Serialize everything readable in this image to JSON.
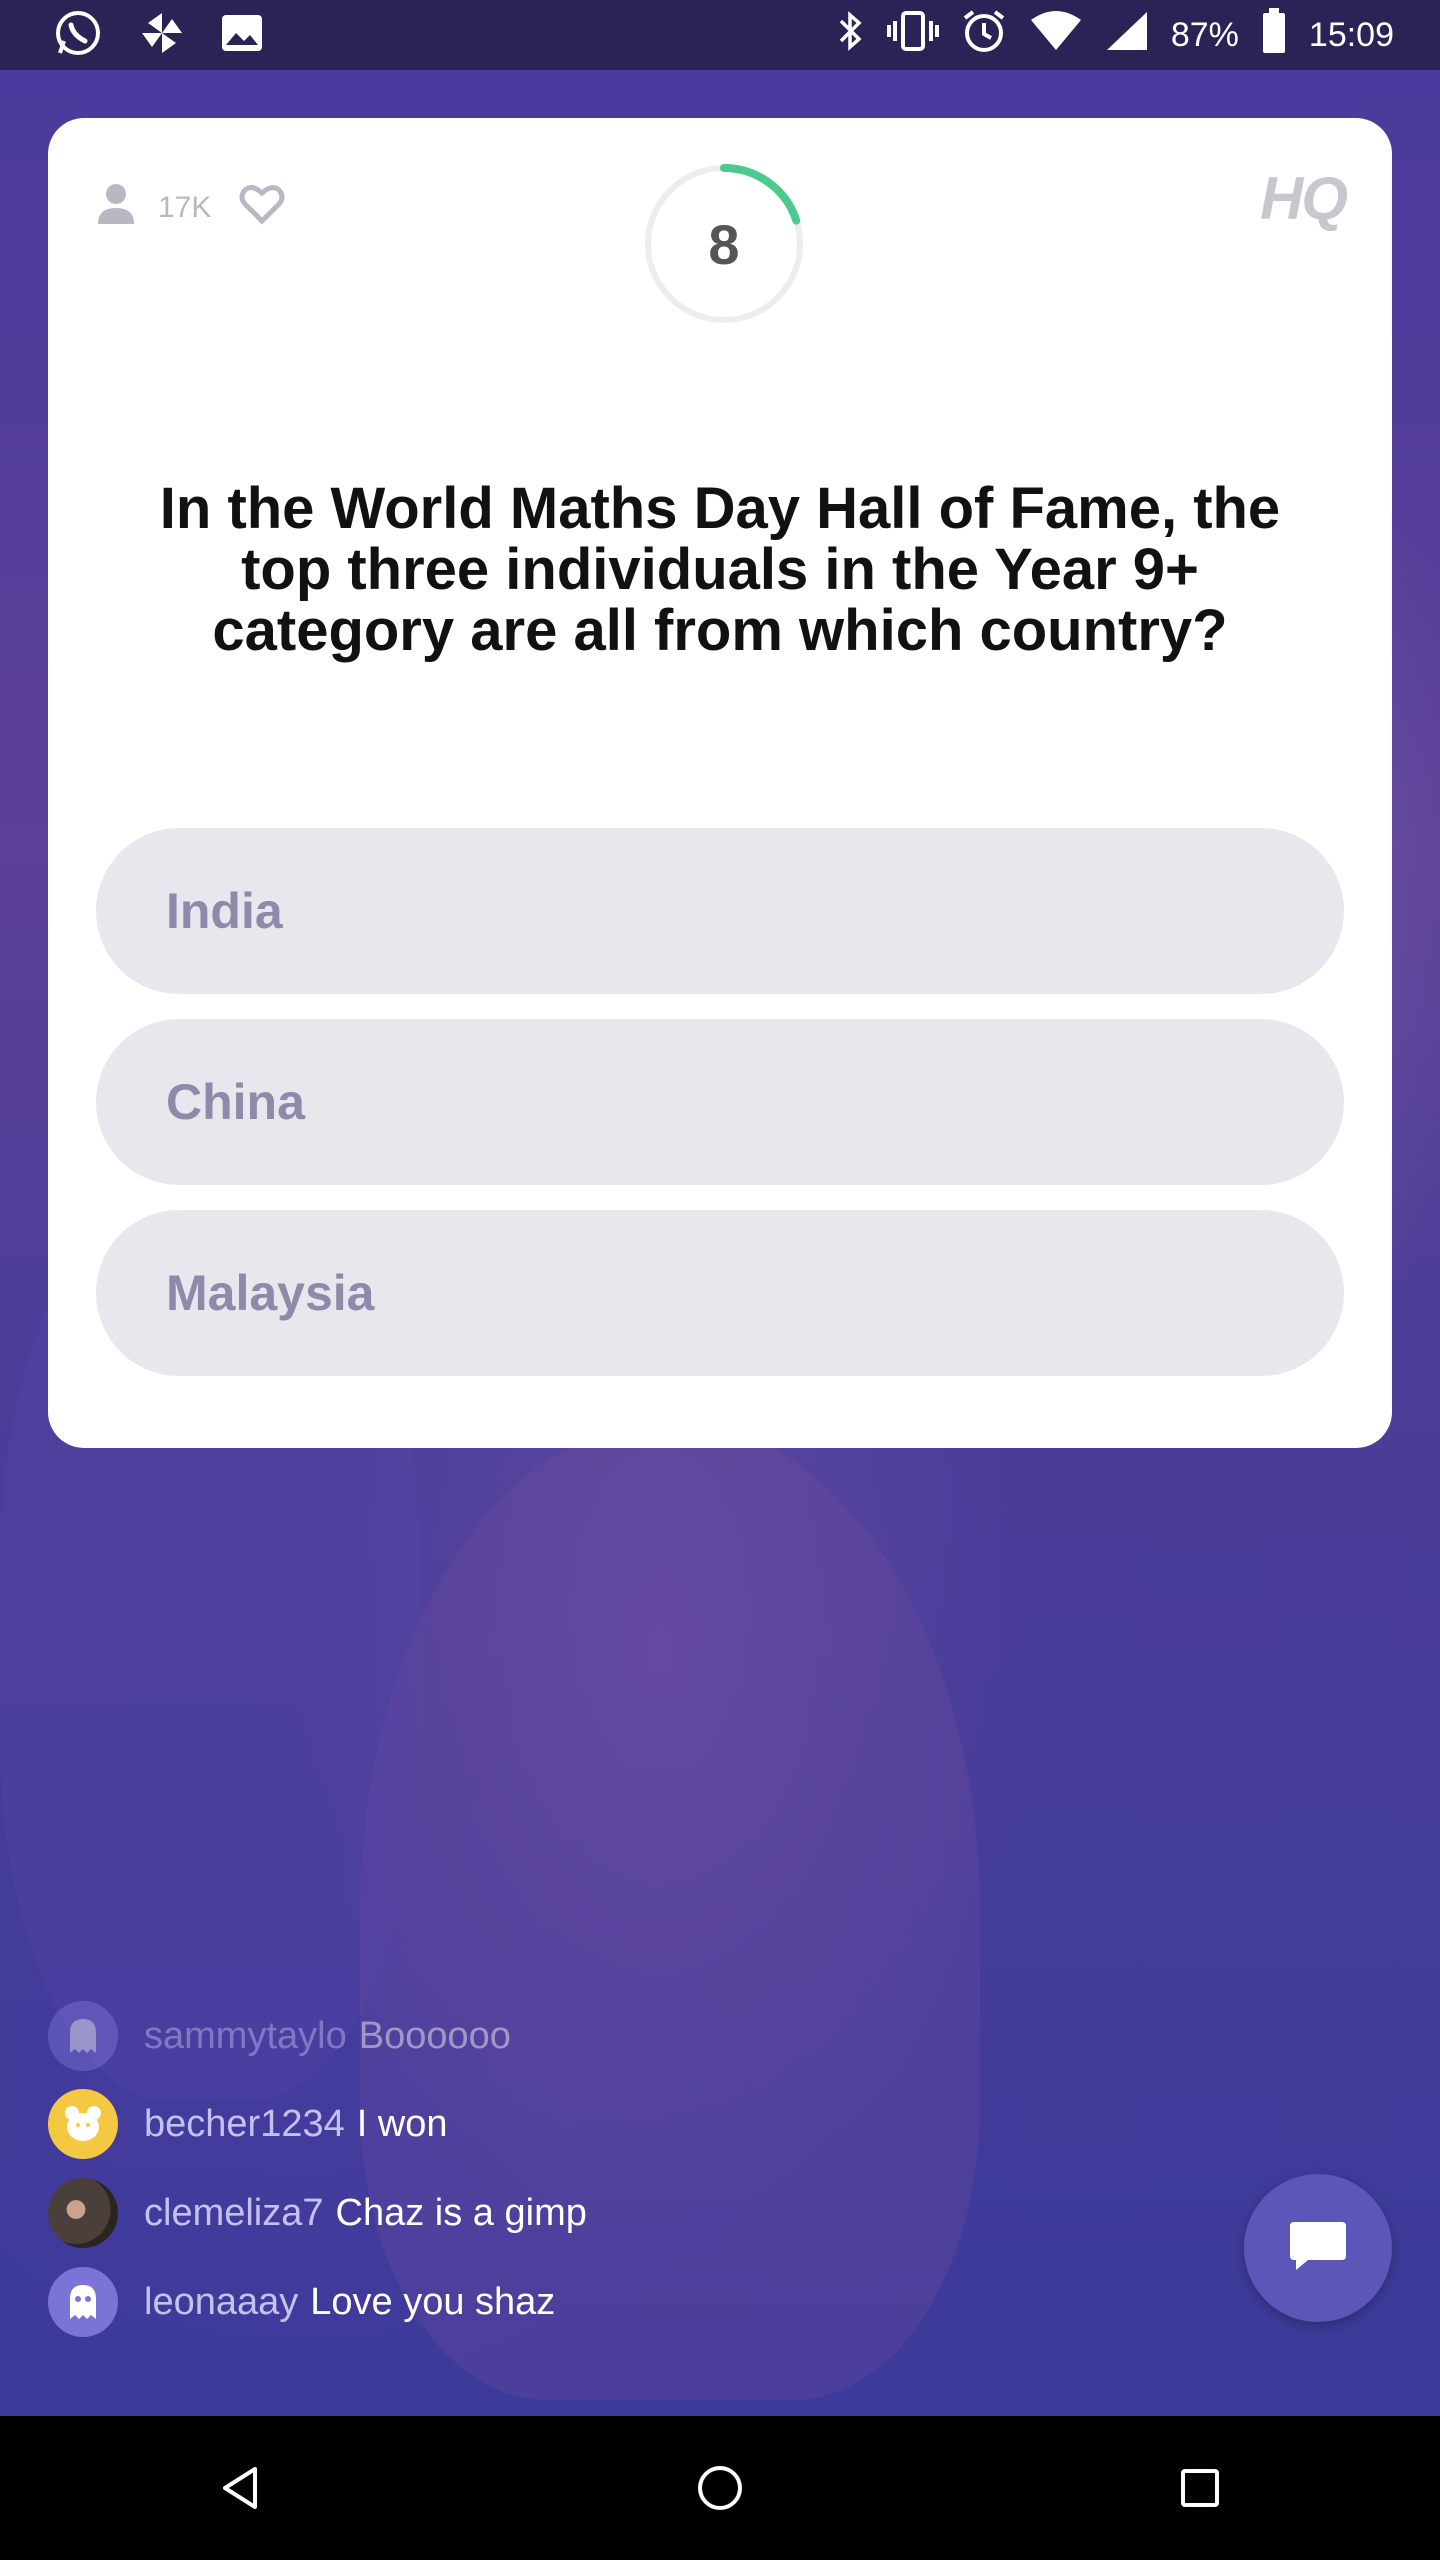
{
  "status_bar": {
    "battery": "87%",
    "time": "15:09",
    "left_icons": [
      "whatsapp-icon",
      "pinwheel-icon",
      "gallery-icon"
    ],
    "right_icons": [
      "bluetooth-icon",
      "vibrate-icon",
      "alarm-icon",
      "wifi-icon",
      "signal-icon",
      "battery-icon"
    ]
  },
  "card": {
    "viewer_count": "17K",
    "timer_value": "8",
    "timer_progress": 0.2,
    "logo": "HQ",
    "question": "In the World Maths Day Hall of Fame, the top three individuals in the Year 9+ category are all from which country?",
    "answers": [
      "India",
      "China",
      "Malaysia"
    ]
  },
  "chat": {
    "messages": [
      {
        "user": "sammytaylo",
        "text": "Boooooo",
        "avatar": "ghost"
      },
      {
        "user": "becher1234",
        "text": "I won",
        "avatar": "bear"
      },
      {
        "user": "clemeliza7",
        "text": "Chaz is a gimp",
        "avatar": "photo"
      },
      {
        "user": "leonaaay",
        "text": "Love you shaz",
        "avatar": "ghost"
      }
    ]
  },
  "colors": {
    "timer_arc": "#4cc98d",
    "answer_bg": "#e8e7ee",
    "answer_text": "#8e8aa9",
    "chat_button": "#5c56b8"
  }
}
